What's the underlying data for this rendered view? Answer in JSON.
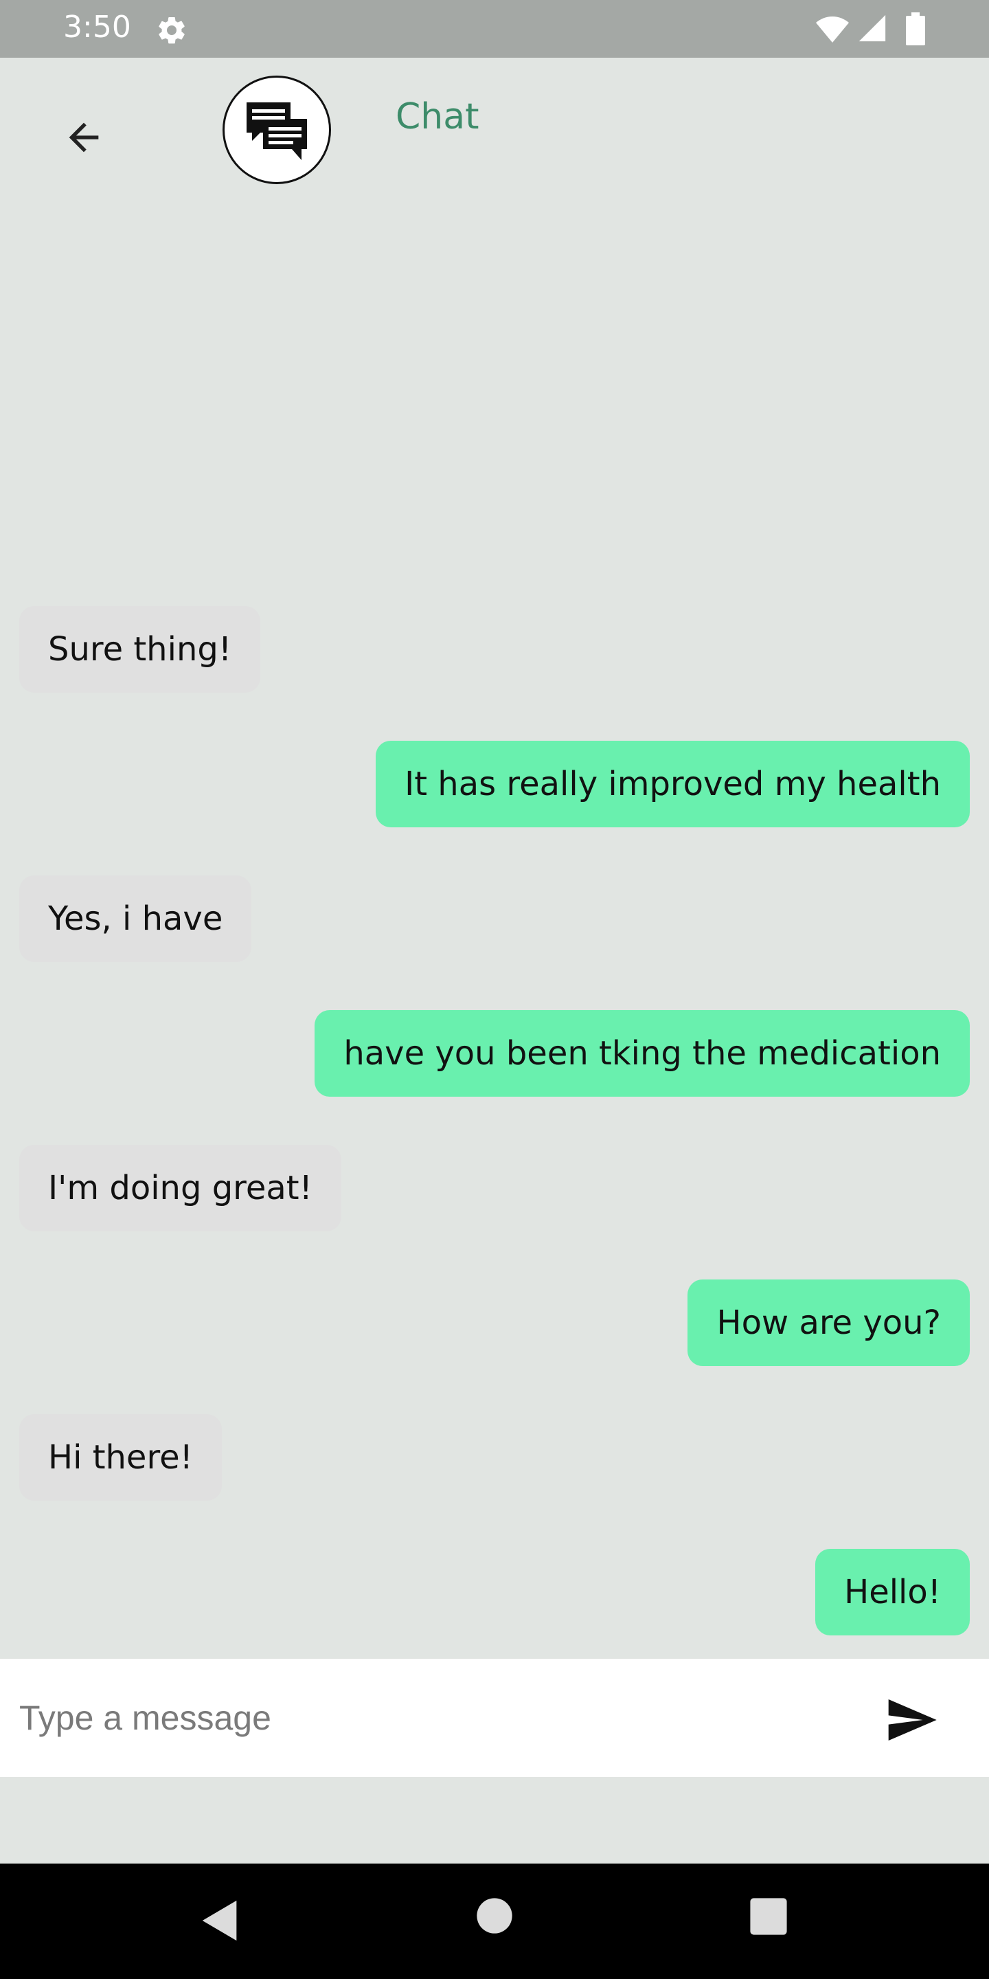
{
  "status_bar": {
    "time": "3:50",
    "icons": [
      "gear-icon",
      "wifi-icon",
      "signal-icon",
      "battery-icon"
    ]
  },
  "header": {
    "title": "Chat",
    "back_icon": "arrow-left-icon",
    "avatar_icon": "chat-bubbles-icon",
    "title_color": "#3d8c6a"
  },
  "messages": [
    {
      "text": "Sure thing!",
      "sender": "other"
    },
    {
      "text": "It has really improved my health",
      "sender": "me"
    },
    {
      "text": "Yes, i have",
      "sender": "other"
    },
    {
      "text": "have you been tking the medication",
      "sender": "me"
    },
    {
      "text": "I'm doing great!",
      "sender": "other"
    },
    {
      "text": "How are you?",
      "sender": "me"
    },
    {
      "text": "Hi there!",
      "sender": "other"
    },
    {
      "text": "Hello!",
      "sender": "me"
    }
  ],
  "composer": {
    "placeholder": "Type a message",
    "value": "",
    "send_icon": "send-icon"
  },
  "colors": {
    "background": "#e1e5e2",
    "outgoing_bubble": "#69f0ae",
    "incoming_bubble": "#e0e0e0",
    "status_bar": "#a4a8a5"
  },
  "nav_bar": {
    "icons": [
      "nav-back-icon",
      "nav-home-icon",
      "nav-recent-icon"
    ]
  }
}
